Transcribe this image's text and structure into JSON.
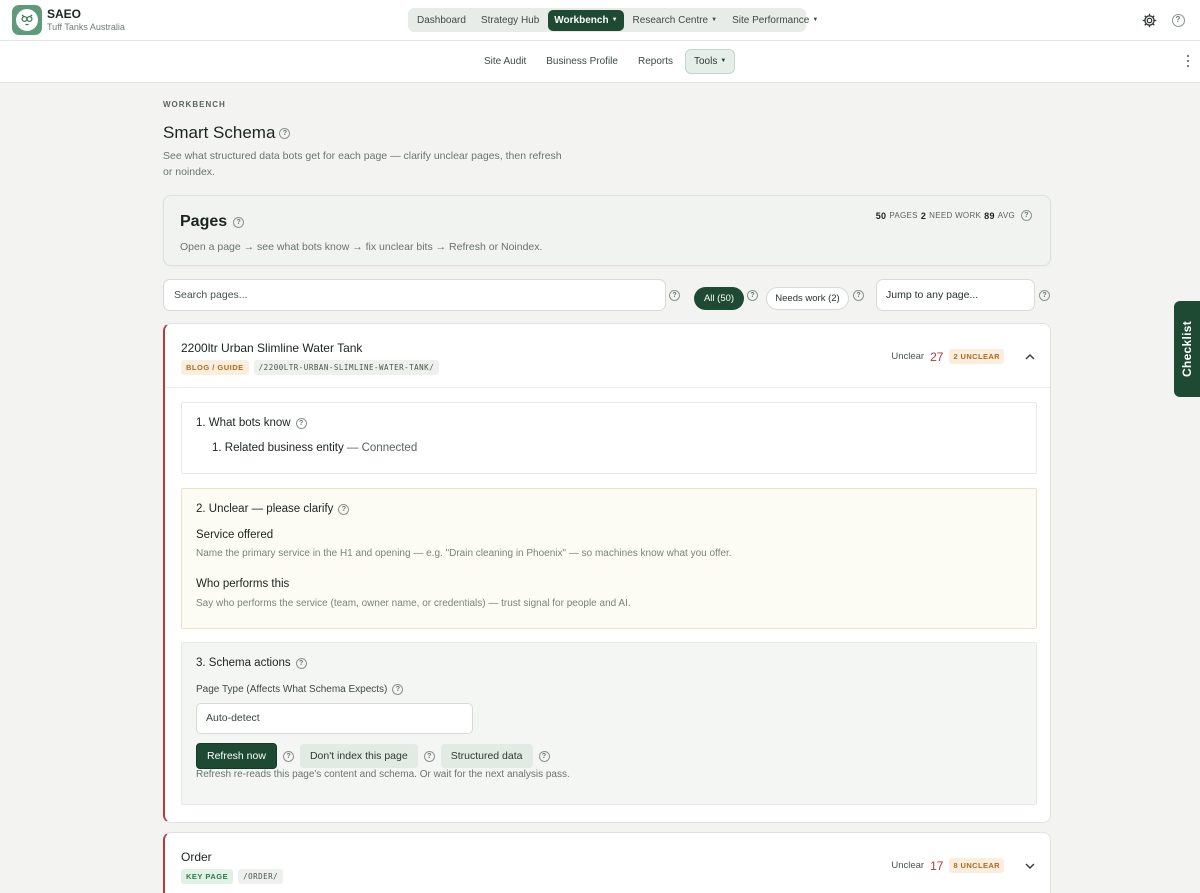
{
  "brand": {
    "name": "SAEO",
    "subtitle": "Tuff Tanks Australia"
  },
  "nav": {
    "items": [
      {
        "label": "Dashboard",
        "active": false,
        "dropdown": false
      },
      {
        "label": "Strategy Hub",
        "active": false,
        "dropdown": false
      },
      {
        "label": "Workbench",
        "active": true,
        "dropdown": true
      },
      {
        "label": "Research Centre",
        "active": false,
        "dropdown": true
      },
      {
        "label": "Site Performance",
        "active": false,
        "dropdown": true
      }
    ]
  },
  "subnav": {
    "items": [
      {
        "label": "Site Audit",
        "active": false
      },
      {
        "label": "Business Profile",
        "active": false
      },
      {
        "label": "Reports",
        "active": false
      },
      {
        "label": "Tools",
        "active": true,
        "dropdown": true
      }
    ]
  },
  "header": {
    "eyebrow": "WORKBENCH",
    "title": "Smart Schema",
    "description": "See what structured data bots get for each page — clarify unclear pages, then refresh or noindex."
  },
  "pages_summary": {
    "title": "Pages",
    "subtitle": "Open a page → see what bots know → fix unclear bits → Refresh or Noindex.",
    "pages_count": "50",
    "pages_label": "PAGES",
    "need_work_count": "2",
    "need_work_label": "NEED WORK",
    "avg_value": "89",
    "avg_label": "AVG"
  },
  "filters": {
    "search_placeholder": "Search pages...",
    "all_label": "All (50)",
    "needs_work_label": "Needs work (2)",
    "jump_placeholder": "Jump to any page..."
  },
  "page_cards": [
    {
      "title": "2200ltr Urban Slimline Water Tank",
      "type_tag": "BLOG / GUIDE",
      "slug": "/2200LTR-URBAN-SLIMLINE-WATER-TANK/",
      "status_label": "Unclear",
      "score": "27",
      "unclear_badge": "2 UNCLEAR",
      "expanded": true,
      "bots_know": {
        "title": "1. What bots know",
        "items": [
          {
            "label": "Related business entity",
            "value": "— Connected"
          }
        ]
      },
      "unclear": {
        "title": "2. Unclear — please clarify",
        "questions": [
          {
            "title": "Service offered",
            "desc": "Name the primary service in the H1 and opening — e.g. \"Drain cleaning in Phoenix\" — so machines know what you offer."
          },
          {
            "title": "Who performs this",
            "desc": "Say who performs the service (team, owner name, or credentials) — trust signal for people and AI."
          }
        ]
      },
      "actions": {
        "title": "3. Schema actions",
        "page_type_label": "Page Type (Affects What Schema Expects)",
        "page_type_value": "Auto-detect",
        "refresh_label": "Refresh now",
        "noindex_label": "Don't index this page",
        "structured_label": "Structured data",
        "note": "Refresh re-reads this page's content and schema. Or wait for the next analysis pass."
      }
    },
    {
      "title": "Order",
      "type_tag": "KEY PAGE",
      "slug": "/ORDER/",
      "status_label": "Unclear",
      "score": "17",
      "unclear_badge": "8 UNCLEAR",
      "expanded": false
    }
  ],
  "checklist_tab": "Checklist",
  "colors": {
    "brand_green": "#1e4a33",
    "alert_red": "#b53a3a",
    "amber": "#b06a1c"
  }
}
